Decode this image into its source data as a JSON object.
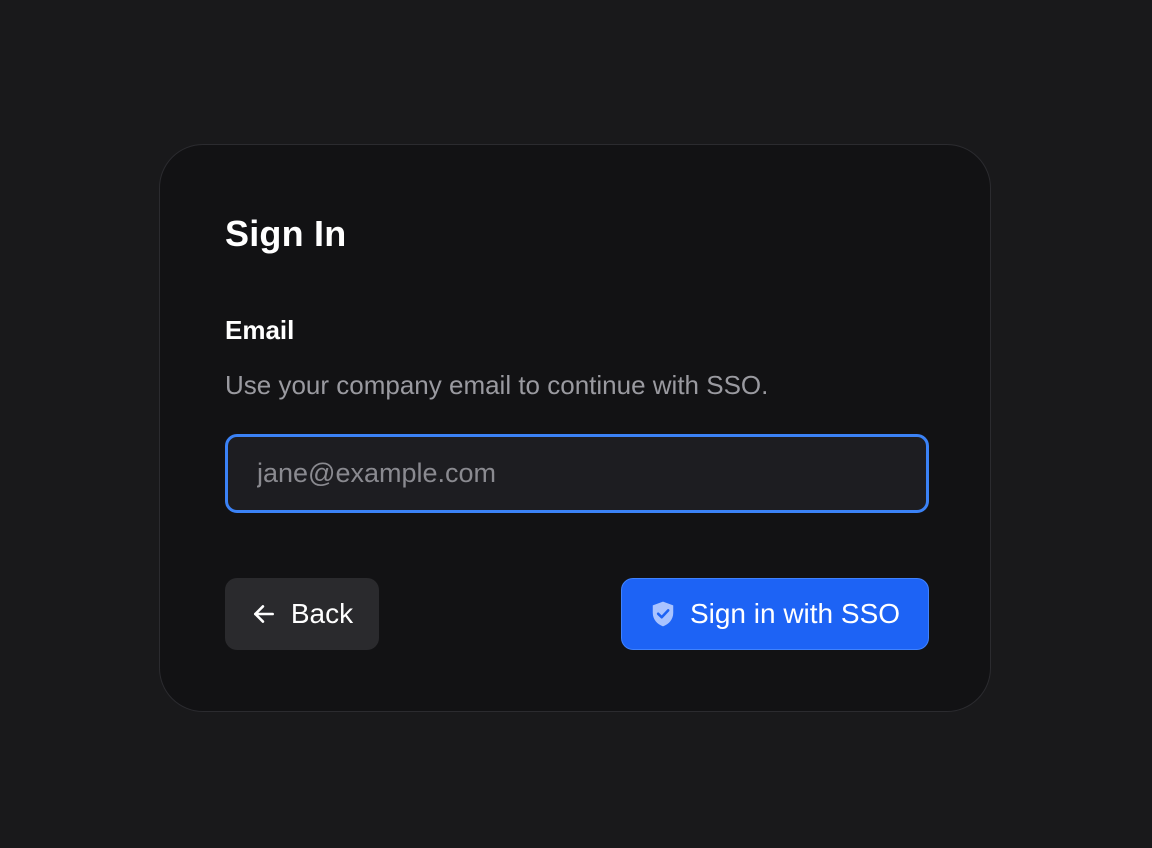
{
  "signin": {
    "title": "Sign In",
    "email_label": "Email",
    "helper_text": "Use your company email to continue with SSO.",
    "email_input": {
      "value": "",
      "placeholder": "jane@example.com"
    },
    "back_button": {
      "label": "Back",
      "icon": "arrow-left-icon"
    },
    "sso_button": {
      "label": "Sign in with SSO",
      "icon": "shield-check-icon"
    }
  },
  "colors": {
    "background": "#19191b",
    "card": "#121214",
    "accent": "#1d63f5",
    "focus_ring": "#3b82f6",
    "secondary_button": "#2a2a2d"
  }
}
